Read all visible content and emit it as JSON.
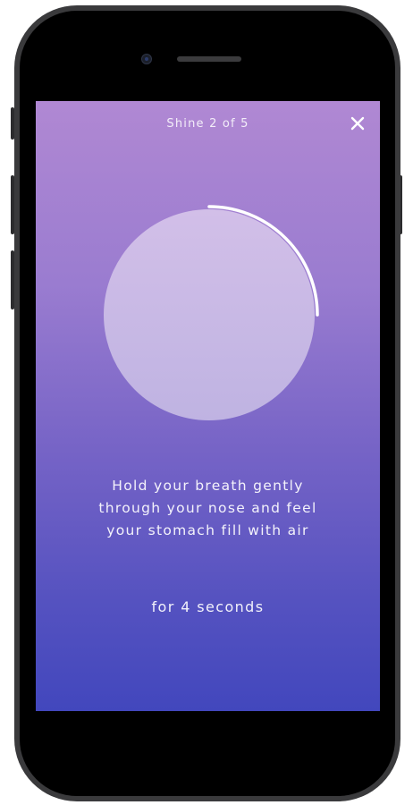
{
  "header": {
    "title": "Shine 2 of 5",
    "close_icon": "close-icon"
  },
  "breath_circle": {
    "progress": 0.25
  },
  "instruction": {
    "line1": "Hold your breath gently",
    "line2": "through your nose and feel",
    "line3": "your stomach fill with air"
  },
  "duration_text": "for 4 seconds",
  "colors": {
    "gradient_top": "#b088d3",
    "gradient_bottom": "#4247bd",
    "circle_fill": "#cbb8e3",
    "progress_stroke": "#ffffff"
  }
}
